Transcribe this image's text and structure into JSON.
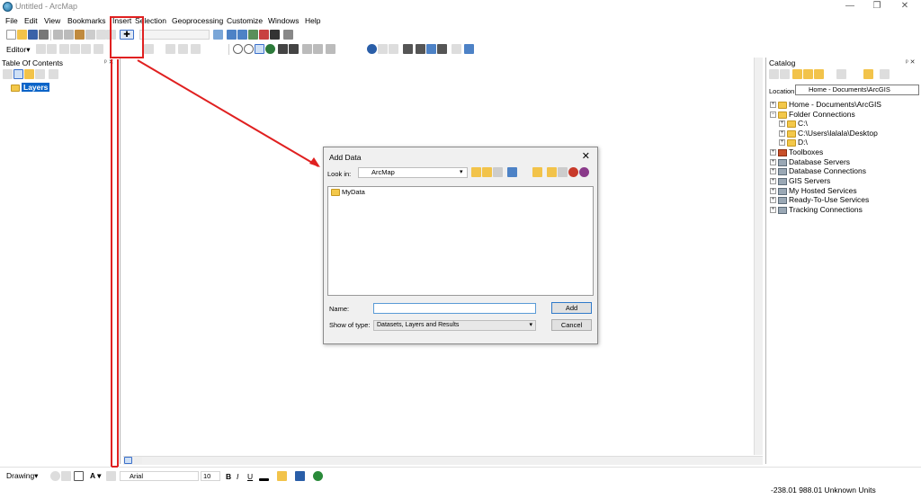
{
  "window": {
    "title": "Untitled - ArcMap",
    "minimize": "—",
    "restore": "❐",
    "close": "✕"
  },
  "menu": [
    "File",
    "Edit",
    "View",
    "Bookmarks",
    "Insert",
    "Selection",
    "Geoprocessing",
    "Customize",
    "Windows",
    "Help"
  ],
  "editor_toolbar": {
    "label": "Editor▾"
  },
  "toc": {
    "title": "Table Of Contents",
    "pin": "ᵖ ✕",
    "root": "Layers"
  },
  "catalog": {
    "title": "Catalog",
    "pin": "ᵖ ✕",
    "location_label": "Location:",
    "location_value": "Home - Documents\\ArcGIS",
    "tree": [
      {
        "label": "Home - Documents\\ArcGIS",
        "icon": "folder-icon",
        "expander": "+"
      },
      {
        "label": "Folder Connections",
        "icon": "folder-icon",
        "expander": "−"
      },
      {
        "label": "C:\\",
        "icon": "folder-icon",
        "expander": "+"
      },
      {
        "label": "C:\\Users\\lalala\\Desktop",
        "icon": "folder-icon",
        "expander": "+"
      },
      {
        "label": "D:\\",
        "icon": "folder-icon",
        "expander": "+"
      },
      {
        "label": "Toolboxes",
        "icon": "toolbox-icon",
        "expander": "+"
      },
      {
        "label": "Database Servers",
        "icon": "server-icon",
        "expander": "+"
      },
      {
        "label": "Database Connections",
        "icon": "server-icon",
        "expander": "+"
      },
      {
        "label": "GIS Servers",
        "icon": "server-icon",
        "expander": "+"
      },
      {
        "label": "My Hosted Services",
        "icon": "server-icon",
        "expander": "+"
      },
      {
        "label": "Ready-To-Use Services",
        "icon": "server-icon",
        "expander": "+"
      },
      {
        "label": "Tracking Connections",
        "icon": "server-icon",
        "expander": "+"
      }
    ]
  },
  "dialog": {
    "title": "Add Data",
    "close": "✕",
    "look_in_label": "Look in:",
    "look_in_value": "ArcMap",
    "files": [
      "MyData"
    ],
    "name_label": "Name:",
    "name_value": "",
    "type_label": "Show of type:",
    "type_value": "Datasets, Layers and Results",
    "add_button": "Add",
    "cancel_button": "Cancel"
  },
  "drawing": {
    "label": "Drawing▾",
    "font": "Arial",
    "size": "10",
    "bold": "B",
    "italic": "I",
    "underline": "U"
  },
  "status": {
    "coords": "-238.01  988.01 Unknown Units"
  },
  "colors": {
    "annotation": "#e02020",
    "selection": "#0a64c8"
  }
}
